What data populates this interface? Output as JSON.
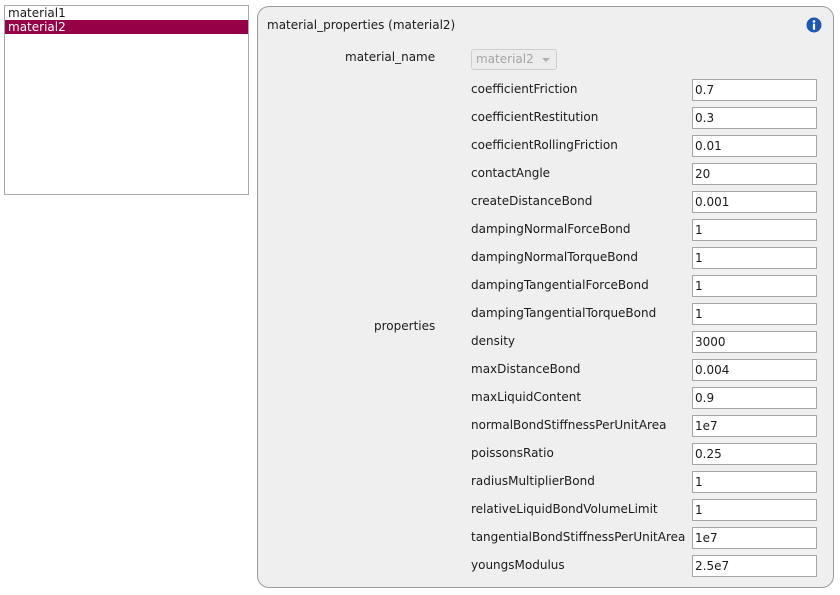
{
  "materials_list": {
    "items": [
      "material1",
      "material2"
    ],
    "selected_index": 1,
    "selected_color": "#960046"
  },
  "panel": {
    "title": "material_properties (material2)",
    "info_icon": "info-icon",
    "material_name_label": "material_name",
    "material_name_value": "material2",
    "properties_label": "properties"
  },
  "properties": [
    {
      "name": "coefficientFriction",
      "value": "0.7"
    },
    {
      "name": "coefficientRestitution",
      "value": "0.3"
    },
    {
      "name": "coefficientRollingFriction",
      "value": "0.01"
    },
    {
      "name": "contactAngle",
      "value": "20"
    },
    {
      "name": "createDistanceBond",
      "value": "0.001"
    },
    {
      "name": "dampingNormalForceBond",
      "value": "1"
    },
    {
      "name": "dampingNormalTorqueBond",
      "value": "1"
    },
    {
      "name": "dampingTangentialForceBond",
      "value": "1"
    },
    {
      "name": "dampingTangentialTorqueBond",
      "value": "1"
    },
    {
      "name": "density",
      "value": "3000"
    },
    {
      "name": "maxDistanceBond",
      "value": "0.004"
    },
    {
      "name": "maxLiquidContent",
      "value": "0.9"
    },
    {
      "name": "normalBondStiffnessPerUnitArea",
      "value": "1e7"
    },
    {
      "name": "poissonsRatio",
      "value": "0.25"
    },
    {
      "name": "radiusMultiplierBond",
      "value": "1"
    },
    {
      "name": "relativeLiquidBondVolumeLimit",
      "value": "1"
    },
    {
      "name": "tangentialBondStiffnessPerUnitArea",
      "value": "1e7"
    },
    {
      "name": "youngsModulus",
      "value": "2.5e7"
    }
  ]
}
